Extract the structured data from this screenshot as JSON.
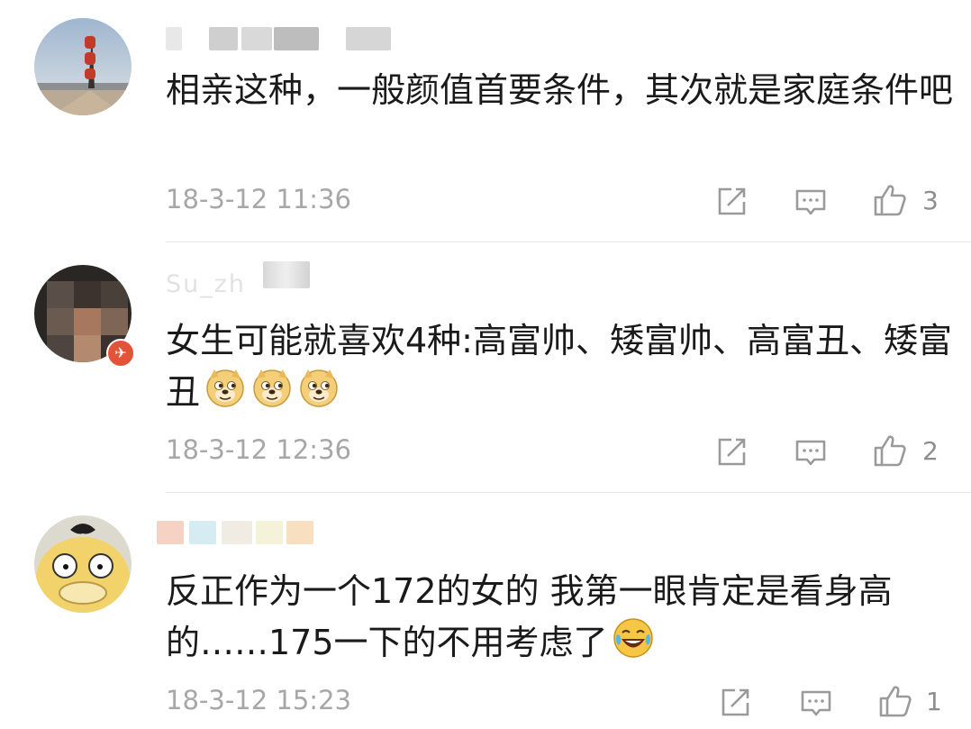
{
  "comments": [
    {
      "text": "相亲这种，一般颜值首要条件，其次就是家庭条件吧",
      "time": "18-3-12 11:36",
      "likes": "3"
    },
    {
      "username": "Su_zh",
      "text": "女生可能就喜欢4种:高富帅、矮富帅、高富丑、矮富丑",
      "time": "18-3-12 12:36",
      "likes": "2"
    },
    {
      "text": "反正作为一个172的女的 我第一眼肯定是看身高的……175一下的不用考虑了",
      "time": "18-3-12 15:23",
      "likes": "1"
    }
  ],
  "colors": {
    "timestamp": "#a7a7a7",
    "icon": "#9a9a9a",
    "divider": "#e6e6e6",
    "badge": "#e2533a"
  },
  "icons": [
    "share-icon",
    "reply-icon",
    "thumbs-up-icon",
    "doge-emoji",
    "laugh-cry-emoji"
  ]
}
